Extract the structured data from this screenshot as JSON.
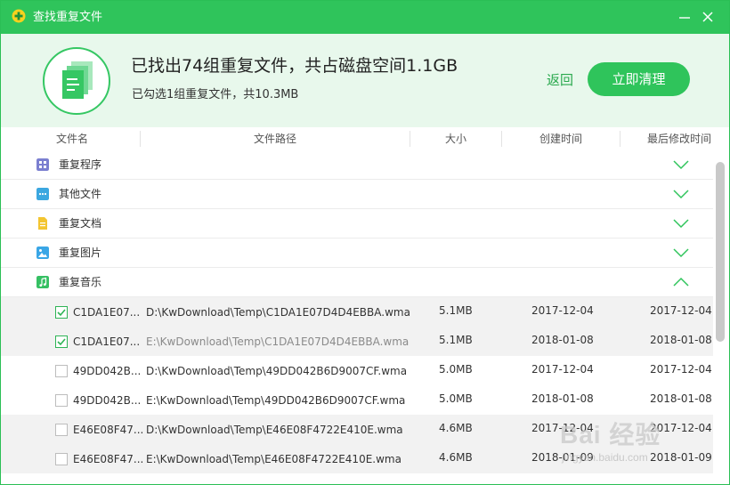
{
  "window": {
    "title": "查找重复文件"
  },
  "summary": {
    "headline": "已找出74组重复文件，共占磁盘空间1.1GB",
    "subline": "已勾选1组重复文件，共10.3MB",
    "back_label": "返回",
    "clean_label": "立即清理"
  },
  "columns": {
    "name": "文件名",
    "path": "文件路径",
    "size": "大小",
    "created": "创建时间",
    "modified": "最后修改时间"
  },
  "categories": [
    {
      "label": "重复程序",
      "icon": "program-grid-icon",
      "color": "#7b7fd0",
      "expanded": false
    },
    {
      "label": "其他文件",
      "icon": "other-file-icon",
      "color": "#3ba7e0",
      "expanded": false
    },
    {
      "label": "重复文档",
      "icon": "document-icon",
      "color": "#f3c531",
      "expanded": false
    },
    {
      "label": "重复图片",
      "icon": "image-icon",
      "color": "#3aa6e6",
      "expanded": false
    },
    {
      "label": "重复音乐",
      "icon": "music-icon",
      "color": "#36c063",
      "expanded": true
    }
  ],
  "files": [
    {
      "checked": true,
      "name": "C1DA1E07...",
      "path": "D:\\KwDownload\\Temp\\C1DA1E07D4D4EBBA.wma",
      "path_muted": false,
      "size": "5.1MB",
      "created": "2017-12-04",
      "modified": "2017-12-04",
      "shaded": true
    },
    {
      "checked": true,
      "name": "C1DA1E07...",
      "path": "E:\\KwDownload\\Temp\\C1DA1E07D4D4EBBA.wma",
      "path_muted": true,
      "size": "5.1MB",
      "created": "2018-01-08",
      "modified": "2018-01-08",
      "shaded": true
    },
    {
      "checked": false,
      "name": "49DD042B...",
      "path": "D:\\KwDownload\\Temp\\49DD042B6D9007CF.wma",
      "path_muted": false,
      "size": "5.0MB",
      "created": "2017-12-04",
      "modified": "2017-12-04",
      "shaded": false
    },
    {
      "checked": false,
      "name": "49DD042B...",
      "path": "E:\\KwDownload\\Temp\\49DD042B6D9007CF.wma",
      "path_muted": false,
      "size": "5.0MB",
      "created": "2018-01-08",
      "modified": "2018-01-08",
      "shaded": false
    },
    {
      "checked": false,
      "name": "E46E08F47...",
      "path": "D:\\KwDownload\\Temp\\E46E08F4722E410E.wma",
      "path_muted": false,
      "size": "4.6MB",
      "created": "2017-12-04",
      "modified": "2017-12-04",
      "shaded": true
    },
    {
      "checked": false,
      "name": "E46E08F47...",
      "path": "E:\\KwDownload\\Temp\\E46E08F4722E410E.wma",
      "path_muted": false,
      "size": "4.6MB",
      "created": "2018-01-09",
      "modified": "2018-01-09",
      "shaded": true
    }
  ],
  "watermark": {
    "main": "Bai 经验",
    "sub": "jingyan.baidu.com"
  },
  "colors": {
    "accent": "#2fc45b",
    "accent_dark": "#2aa94e",
    "summary_bg": "#e8f8ec",
    "row_shade": "#f2f2f2"
  }
}
